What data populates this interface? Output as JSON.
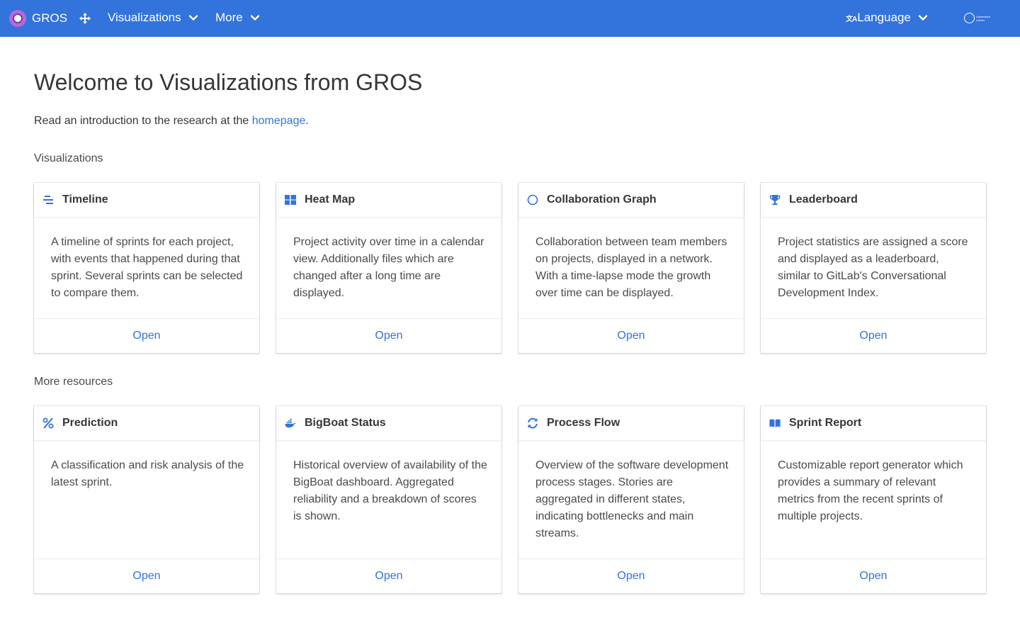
{
  "navbar": {
    "brand": "GROS",
    "visualizations": "Visualizations",
    "more": "More",
    "language": "Language",
    "lang_icon": "文A",
    "uni_logo_text": "Universiteit Leiden",
    "color": "#3273dc"
  },
  "page": {
    "title": "Welcome to Visualizations from GROS",
    "intro_text": "Read an introduction to the research at the ",
    "intro_link": "homepage",
    "intro_end": "."
  },
  "sections": {
    "visualizations": "Visualizations",
    "more_resources": "More resources"
  },
  "cards": [
    {
      "title": "Timeline",
      "icon": "timeline-icon",
      "text": "A timeline of sprints for each project, with events that happened during that sprint. Several sprints can be selected to compare them.",
      "action": "Open"
    },
    {
      "title": "Heat Map",
      "icon": "windows-icon",
      "text": "Project activity over time in a calendar view. Additionally files which are changed after a long time are displayed.",
      "action": "Open"
    },
    {
      "title": "Collaboration Graph",
      "icon": "circle-icon",
      "text": "Collaboration between team members on projects, displayed in a network. With a time-lapse mode the growth over time can be displayed.",
      "action": "Open"
    },
    {
      "title": "Leaderboard",
      "icon": "trophy-icon",
      "text": "Project statistics are assigned a score and displayed as a leaderboard, similar to GitLab's Conversational Development Index.",
      "action": "Open"
    },
    {
      "title": "Prediction",
      "icon": "percent-icon",
      "text": "A classification and risk analysis of the latest sprint.",
      "action": "Open"
    },
    {
      "title": "BigBoat Status",
      "icon": "docker-icon",
      "text": "Historical overview of availability of the BigBoat dashboard. Aggregated reliability and a breakdown of scores is shown.",
      "action": "Open"
    },
    {
      "title": "Process Flow",
      "icon": "sync-icon",
      "text": "Overview of the software development process stages. Stories are aggregated in different states, indicating bottlenecks and main streams.",
      "action": "Open"
    },
    {
      "title": "Sprint Report",
      "icon": "book-icon",
      "text": "Customizable report generator which provides a summary of relevant metrics from the recent sprints of multiple projects.",
      "action": "Open"
    }
  ]
}
